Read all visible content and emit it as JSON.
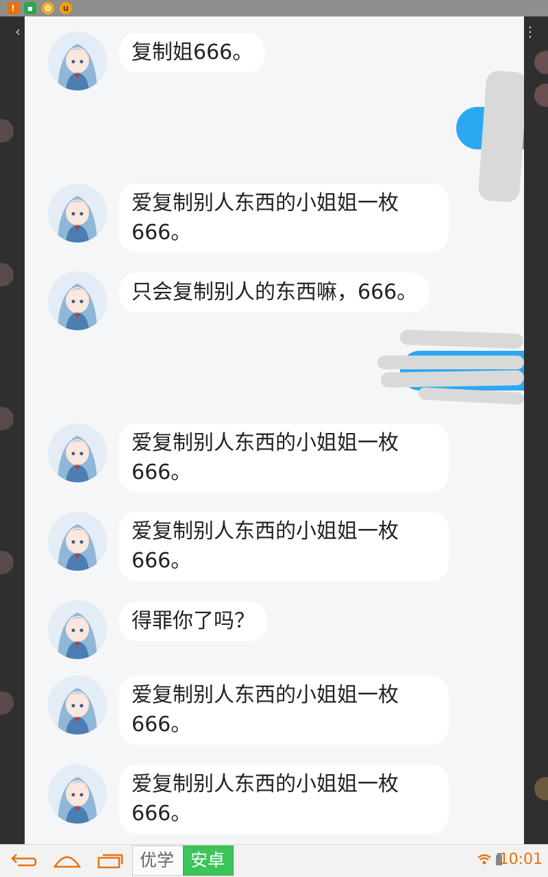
{
  "status_bar": {
    "left_icons": [
      "warning-icon",
      "gallery-icon",
      "game-icon",
      "uc-browser-icon"
    ]
  },
  "messages": [
    {
      "text": "复制姐666。"
    },
    {
      "text": "爱复制别人东西的小姐姐一枚\n666。"
    },
    {
      "text": "只会复制别人的东西嘛，666。"
    },
    {
      "text": "爱复制别人东西的小姐姐一枚\n666。"
    },
    {
      "text": "爱复制别人东西的小姐姐一枚\n666。"
    },
    {
      "text": "得罪你了吗？"
    },
    {
      "text": "爱复制别人东西的小姐姐一枚\n666。"
    },
    {
      "text": "爱复制别人东西的小姐姐一枚\n666。"
    }
  ],
  "nav_bar": {
    "ad_left": "优学",
    "ad_right": "安卓",
    "clock": "10:01"
  },
  "colors": {
    "accent": "#2aa8f2",
    "clock": "#e8720c",
    "ad_green": "#3cc55a"
  }
}
